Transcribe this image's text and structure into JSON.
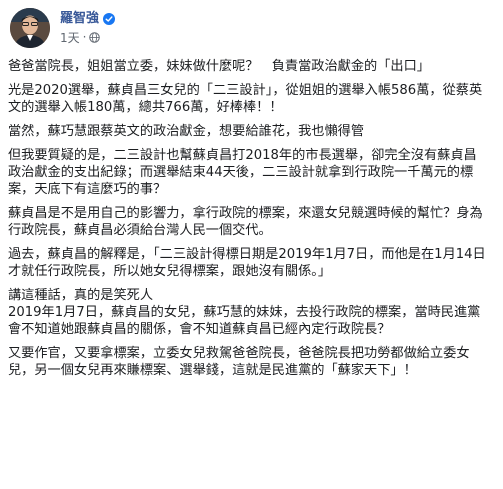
{
  "post": {
    "author": "羅智強",
    "timestamp": "1天",
    "separator": "·",
    "paragraphs": [
      "爸爸當院長，姐姐當立委，妹妹做什麼呢？　負責當政治獻金的「出口」",
      "光是2020選舉，蘇貞昌三女兒的「二三設計」，從姐姐的選舉入帳586萬，從蔡英文的選舉入帳180萬，總共766萬，好棒棒！！",
      "當然，蘇巧慧跟蔡英文的政治獻金，想要給誰花，我也懶得管",
      "但我要質疑的是，二三設計也幫蘇貞昌打2018年的市長選舉，卻完全沒有蘇貞昌政治獻金的支出紀錄；而選舉結束44天後，二三設計就拿到行政院一千萬元的標案，天底下有這麼巧的事？",
      "蘇貞昌是不是用自己的影響力，拿行政院的標案，來還女兒競選時候的幫忙？身為行政院長，蘇貞昌必須給台灣人民一個交代。",
      "過去，蘇貞昌的解釋是，「二三設計得標日期是2019年1月7日，而他是在1月14日才就任行政院長，所以她女兒得標案，跟她沒有關係。」",
      "講這種話，真的是笑死人\n2019年1月7日，蘇貞昌的女兒，蘇巧慧的妹妹，去投行政院的標案，當時民進黨會不知道她跟蘇貞昌的關係，會不知道蘇貞昌已經內定行政院長？",
      "又要作官，又要拿標案，立委女兒救駕爸爸院長，爸爸院長把功勞都做給立委女兒，另一個女兒再來賺標案、選舉錢，這就是民進黨的「蘇家天下」！"
    ]
  },
  "icons": {
    "verified": "verified-badge-icon",
    "audience": "globe-icon"
  },
  "colors": {
    "author": "#385898",
    "meta": "#606770",
    "text": "#1c1e21",
    "verified": "#1877f2"
  }
}
